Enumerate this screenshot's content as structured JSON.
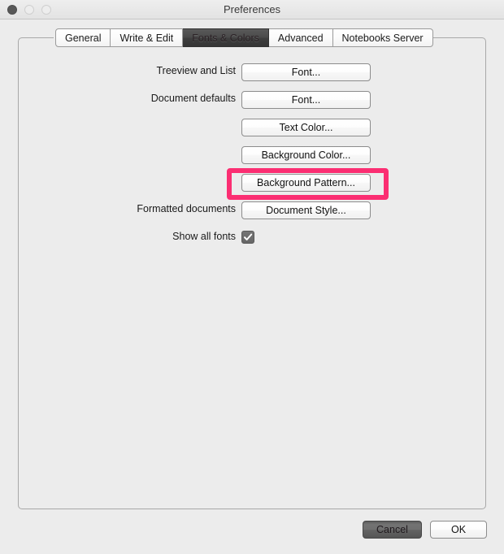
{
  "window": {
    "title": "Preferences",
    "controls": {
      "close": "close-button",
      "minimize": "minimize-button",
      "zoom": "zoom-button"
    }
  },
  "tabs": [
    {
      "label": "General",
      "selected": false
    },
    {
      "label": "Write & Edit",
      "selected": false
    },
    {
      "label": "Fonts & Colors",
      "selected": true
    },
    {
      "label": "Advanced",
      "selected": false
    },
    {
      "label": "Notebooks Server",
      "selected": false
    }
  ],
  "form": {
    "rows": [
      {
        "label": "Treeview and List",
        "button": "Font...",
        "control": "button"
      },
      {
        "label": "Document defaults",
        "button": "Font...",
        "control": "button"
      },
      {
        "label": "",
        "button": "Text Color...",
        "control": "button"
      },
      {
        "label": "",
        "button": "Background Color...",
        "control": "button"
      },
      {
        "label": "",
        "button": "Background Pattern...",
        "control": "button",
        "highlighted": true
      },
      {
        "label": "Formatted documents",
        "button": "Document Style...",
        "control": "button"
      },
      {
        "label": "Show all fonts",
        "button": "",
        "control": "checkbox",
        "checked": true
      }
    ]
  },
  "footer": {
    "cancel_label": "Cancel",
    "ok_label": "OK"
  },
  "colors": {
    "highlight": "#fb2e72",
    "window_background": "#ececec",
    "selected_tab": "#4a4a4a",
    "checkbox_fill": "#6b6b6b"
  }
}
